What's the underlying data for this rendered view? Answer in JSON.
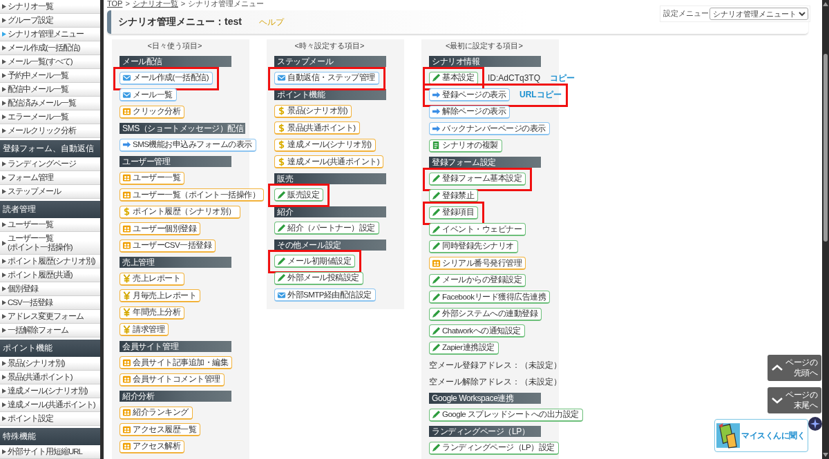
{
  "sidebar": {
    "groups": [
      {
        "items": [
          {
            "label": "シナリオ一覧",
            "selected": false
          },
          {
            "label": "グループ設定",
            "selected": false
          },
          {
            "label": "シナリオ管理メニュー",
            "selected": true
          },
          {
            "label": "メール作成(一括配信)",
            "selected": false
          },
          {
            "label": "メール一覧(すべて)",
            "selected": false
          },
          {
            "label": "予約中メール一覧",
            "selected": false
          },
          {
            "label": "配信中メール一覧",
            "selected": false
          },
          {
            "label": "配信済みメール一覧",
            "selected": false
          },
          {
            "label": "エラーメール一覧",
            "selected": false
          },
          {
            "label": "メールクリック分析",
            "selected": false
          }
        ]
      },
      {
        "title": "登録フォーム、自動返信",
        "items": [
          {
            "label": "ランディングページ",
            "selected": false
          },
          {
            "label": "フォーム管理",
            "selected": false
          },
          {
            "label": "ステップメール",
            "selected": false
          }
        ]
      },
      {
        "title": "読者管理",
        "items": [
          {
            "label": "ユーザー一覧",
            "selected": false
          },
          {
            "label": "ユーザー一覧\n(ポイント一括操作)",
            "selected": false
          },
          {
            "label": "ポイント履歴(シナリオ別)",
            "selected": false
          },
          {
            "label": "ポイント履歴(共通)",
            "selected": false
          },
          {
            "label": "個別登録",
            "selected": false
          },
          {
            "label": "CSV一括登録",
            "selected": false
          },
          {
            "label": "アドレス変更フォーム",
            "selected": false
          },
          {
            "label": "一括解除フォーム",
            "selected": false
          }
        ]
      },
      {
        "title": "ポイント機能",
        "items": [
          {
            "label": "景品(シナリオ別)",
            "selected": false
          },
          {
            "label": "景品(共通ポイント)",
            "selected": false
          },
          {
            "label": "達成メール(シナリオ別)",
            "selected": false
          },
          {
            "label": "達成メール(共通ポイント)",
            "selected": false
          },
          {
            "label": "ポイント設定",
            "selected": false
          }
        ]
      },
      {
        "title": "特殊機能",
        "items": [
          {
            "label": "外部サイト用短縮URL",
            "selected": false
          }
        ]
      }
    ]
  },
  "breadcrumb": {
    "separator": ">",
    "items": [
      {
        "label": "TOP",
        "link": true
      },
      {
        "label": "シナリオ一覧",
        "link": true
      },
      {
        "label": "シナリオ管理メニュー",
        "link": false
      }
    ]
  },
  "settings_menu": {
    "label": "設定メニュー",
    "value": "シナリオ管理メニュート"
  },
  "page_header": {
    "title": "シナリオ管理メニュー：test",
    "help": "ヘルプ"
  },
  "columns": [
    {
      "title": "<日々使う項目>",
      "sections": [
        {
          "title": "メール配信",
          "items": [
            {
              "kind": "mail",
              "label": "メール作成(一括配信)",
              "highlighted": true
            },
            {
              "kind": "mail",
              "label": "メール一覧",
              "highlighted": false
            },
            {
              "kind": "card",
              "label": "クリック分析",
              "highlighted": false
            }
          ]
        },
        {
          "title": "SMS（ショートメッセージ）配信",
          "items": [
            {
              "kind": "arrow",
              "label": "SMS機能お申込みフォームの表示",
              "highlighted": false
            }
          ]
        },
        {
          "title": "ユーザー管理",
          "items": [
            {
              "kind": "card",
              "label": "ユーザー一覧",
              "highlighted": false
            },
            {
              "kind": "card",
              "label": "ユーザー一覧（ポイント一括操作）",
              "highlighted": false
            },
            {
              "kind": "dollar",
              "label": "ポイント履歴（シナリオ別）",
              "highlighted": false
            },
            {
              "kind": "card",
              "label": "ユーザー個別登録",
              "highlighted": false
            },
            {
              "kind": "card",
              "label": "ユーザーCSV一括登録",
              "highlighted": false
            }
          ]
        },
        {
          "title": "売上管理",
          "items": [
            {
              "kind": "yen",
              "label": "売上レポート",
              "highlighted": false
            },
            {
              "kind": "yen",
              "label": "月毎売上レポート",
              "highlighted": false
            },
            {
              "kind": "yen",
              "label": "年間売上分析",
              "highlighted": false
            },
            {
              "kind": "yen",
              "label": "請求管理",
              "highlighted": false
            }
          ]
        },
        {
          "title": "会員サイト管理",
          "items": [
            {
              "kind": "card",
              "label": "会員サイト記事追加・編集",
              "highlighted": false
            },
            {
              "kind": "card",
              "label": "会員サイトコメント管理",
              "highlighted": false
            }
          ]
        },
        {
          "title": "紹介分析",
          "items": [
            {
              "kind": "card",
              "label": "紹介ランキング",
              "highlighted": false
            },
            {
              "kind": "card",
              "label": "アクセス履歴一覧",
              "highlighted": false
            },
            {
              "kind": "card",
              "label": "アクセス解析",
              "highlighted": false
            }
          ]
        }
      ]
    },
    {
      "title": "<時々設定する項目>",
      "sections": [
        {
          "title": "ステップメール",
          "items": [
            {
              "kind": "mail",
              "label": "自動返信・ステップ管理",
              "highlighted": true
            }
          ]
        },
        {
          "title": "ポイント機能",
          "items": [
            {
              "kind": "dollar",
              "label": "景品(シナリオ別)",
              "highlighted": false
            },
            {
              "kind": "dollar",
              "label": "景品(共通ポイント)",
              "highlighted": false
            },
            {
              "kind": "dollar",
              "label": "達成メール(シナリオ別)",
              "highlighted": false
            },
            {
              "kind": "dollar",
              "label": "達成メール(共通ポイント)",
              "highlighted": false
            }
          ]
        },
        {
          "title": "販売",
          "items": [
            {
              "kind": "pencil",
              "label": "販売設定",
              "highlighted": true
            }
          ]
        },
        {
          "title": "紹介",
          "items": [
            {
              "kind": "pencil",
              "label": "紹介（パートナー）設定",
              "highlighted": false
            }
          ]
        },
        {
          "title": "その他メール設定",
          "items": [
            {
              "kind": "pencil",
              "label": "メール初期値設定",
              "highlighted": true
            },
            {
              "kind": "pencil",
              "label": "外部メール投稿設定",
              "highlighted": false
            },
            {
              "kind": "mail",
              "label": "外部SMTP経由配信設定",
              "highlighted": false
            }
          ]
        }
      ]
    },
    {
      "title": "<最初に設定する項目>",
      "sections": [
        {
          "title": "シナリオ情報",
          "items": [
            {
              "kind": "pencil",
              "label": "基本設定",
              "highlighted": true,
              "note": "ID:AdCTq3TQ",
              "link": "コピー"
            },
            {
              "kind": "arrow",
              "label": "登録ページの表示",
              "highlighted": true,
              "link": "URLコピー"
            },
            {
              "kind": "arrow",
              "label": "解除ページの表示",
              "highlighted": false
            },
            {
              "kind": "arrow",
              "label": "バックナンバーページの表示",
              "highlighted": false
            },
            {
              "kind": "copy",
              "label": "シナリオの複製",
              "highlighted": false
            }
          ]
        },
        {
          "title": "登録フォーム設定",
          "items": [
            {
              "kind": "pencil",
              "label": "登録フォーム基本設定",
              "highlighted": true
            },
            {
              "kind": "pencil",
              "label": "登録禁止",
              "highlighted": false
            },
            {
              "kind": "pencil",
              "label": "登録項目",
              "highlighted": true
            },
            {
              "kind": "pencil",
              "label": "イベント・ウェビナー",
              "highlighted": false
            },
            {
              "kind": "pencil",
              "label": "同時登録先シナリオ",
              "highlighted": false
            },
            {
              "kind": "card",
              "label": "シリアル番号発行管理",
              "highlighted": false
            },
            {
              "kind": "pencil",
              "label": "メールからの登録設定",
              "highlighted": false
            },
            {
              "kind": "pencil",
              "label": "Facebookリード獲得広告連携",
              "highlighted": false
            },
            {
              "kind": "pencil",
              "label": "外部システムへの連動登録",
              "highlighted": false
            },
            {
              "kind": "pencil",
              "label": "Chatworkへの通知設定",
              "highlighted": false
            },
            {
              "kind": "pencil",
              "label": "Zapier連携設定",
              "highlighted": false
            },
            {
              "kind": "text",
              "label": "空メール登録アドレス：（未設定）"
            },
            {
              "kind": "text",
              "label": "空メール解除アドレス：（未設定）"
            }
          ]
        },
        {
          "title": "Google Workspace連携",
          "items": [
            {
              "kind": "pencil",
              "label": "Google スプレッドシートへの出力設定",
              "highlighted": false
            }
          ]
        },
        {
          "title": "ランディングページ（LP）",
          "items": [
            {
              "kind": "pencil",
              "label": "ランディングページ（LP）設定",
              "highlighted": false
            }
          ]
        }
      ]
    }
  ],
  "page_nav": [
    {
      "kind": "top",
      "lines": [
        "ページの",
        "先頭へ"
      ]
    },
    {
      "kind": "bottom",
      "lines": [
        "ページの",
        "末尾へ"
      ]
    }
  ],
  "chat_button": {
    "label": "マイスくんに聞く"
  }
}
